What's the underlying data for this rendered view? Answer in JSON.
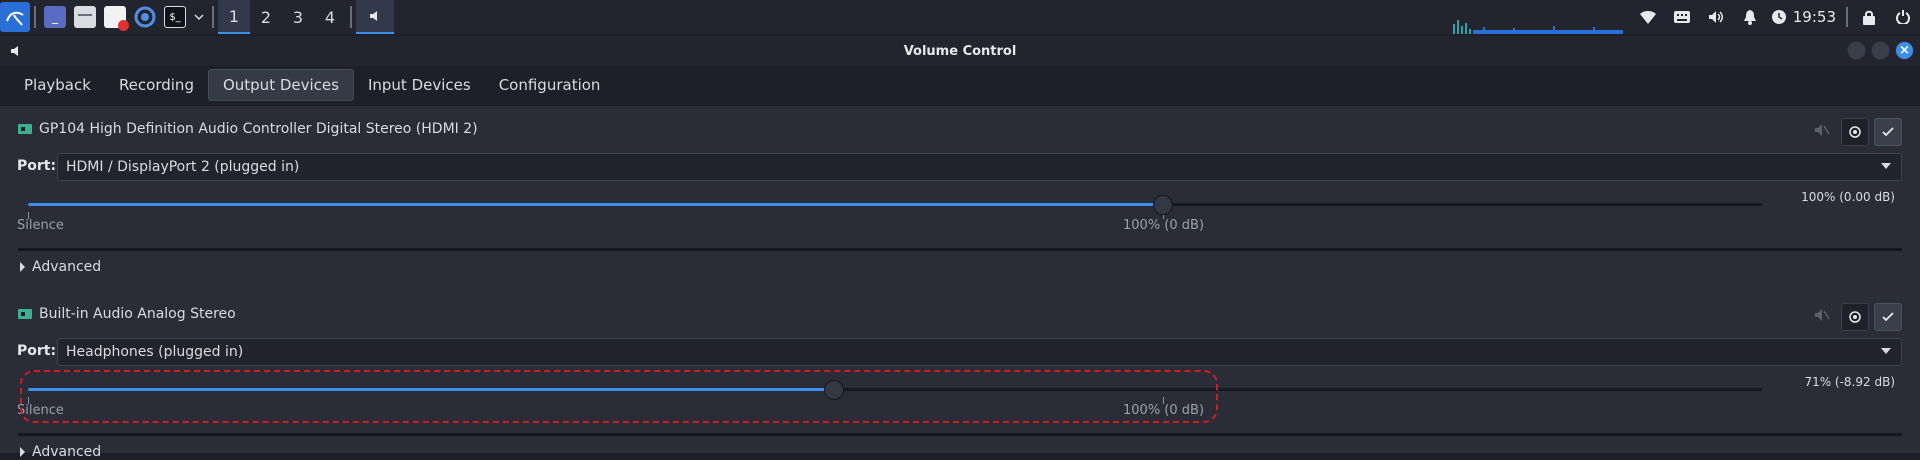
{
  "taskbar": {
    "workspaces": [
      "1",
      "2",
      "3",
      "4"
    ],
    "active_workspace": 0,
    "clock": "19:53"
  },
  "window": {
    "title": "Volume Control",
    "tabs": [
      "Playback",
      "Recording",
      "Output Devices",
      "Input Devices",
      "Configuration"
    ],
    "active_tab": 2
  },
  "devices": [
    {
      "name": "GP104 High Definition Audio Controller Digital Stereo (HDMI 2)",
      "port_label": "Port:",
      "port_value": "HDMI / DisplayPort 2 (plugged in)",
      "volume_fraction": 1.0,
      "volume_text": "100% (0.00 dB)",
      "silence_label": "Silence",
      "hundred_label": "100% (0 dB)",
      "advanced_label": "Advanced"
    },
    {
      "name": "Built-in Audio Analog Stereo",
      "port_label": "Port:",
      "port_value": "Headphones (plugged in)",
      "volume_fraction": 0.71,
      "volume_text": "71% (-8.92 dB)",
      "silence_label": "Silence",
      "hundred_label": "100% (0 dB)",
      "advanced_label": "Advanced"
    }
  ],
  "colors": {
    "accent": "#3d8ee8",
    "highlight": "#d11d1d",
    "card_icon": "#3fb08f"
  },
  "icons": [
    "kali-menu-icon",
    "terminal-window-icon",
    "file-manager-icon",
    "text-editor-icon",
    "browser-icon",
    "terminal-icon",
    "volume-icon",
    "wifi-icon",
    "keyboard-icon",
    "speaker-icon",
    "bell-icon",
    "clock-icon",
    "lock-icon",
    "power-icon",
    "mute-icon",
    "record-icon",
    "check-icon",
    "chevron-down-icon"
  ]
}
